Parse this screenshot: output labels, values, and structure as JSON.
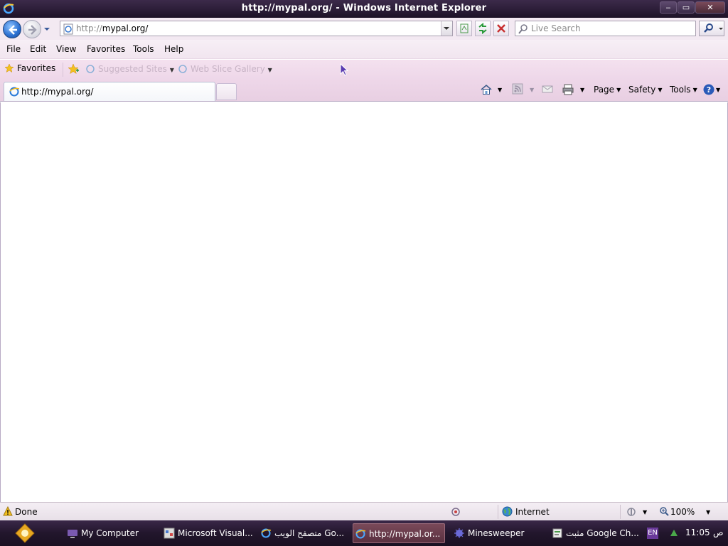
{
  "window": {
    "title": "http://mypal.org/ - Windows Internet Explorer",
    "min_glyph": "‒",
    "max_glyph": "▭",
    "close_glyph": "✕"
  },
  "address": {
    "url_proto": "http://",
    "url_host": "mypal.org/",
    "search_placeholder": "Live Search"
  },
  "menu": {
    "items": [
      "File",
      "Edit",
      "View",
      "Favorites",
      "Tools",
      "Help"
    ]
  },
  "favorites_bar": {
    "favorites_label": "Favorites",
    "links": [
      "Suggested Sites",
      "Web Slice Gallery"
    ]
  },
  "tabs": {
    "active_label": "http://mypal.org/"
  },
  "command_bar": {
    "page_label": "Page",
    "safety_label": "Safety",
    "tools_label": "Tools"
  },
  "status": {
    "text": "Done",
    "zone": "Internet",
    "zoom": "100%"
  },
  "taskbar": {
    "items": [
      {
        "label": "My Computer",
        "icon": "computer-icon"
      },
      {
        "label": "Microsoft Visual...",
        "icon": "visual-studio-icon"
      },
      {
        "label": "متصفح الويب Go...",
        "icon": "ie-icon"
      },
      {
        "label": "http://mypal.or...",
        "icon": "ie-icon"
      },
      {
        "label": "Minesweeper",
        "icon": "minesweeper-icon"
      },
      {
        "label": "مثبت Google Ch...",
        "icon": "installer-icon"
      }
    ],
    "lang": "EN",
    "clock": "11:05",
    "ampm": "ص"
  },
  "colors": {
    "accent": "#2a6fd0",
    "titlebar": "#2a1c36",
    "chrome_pink": "#eed7e9"
  }
}
